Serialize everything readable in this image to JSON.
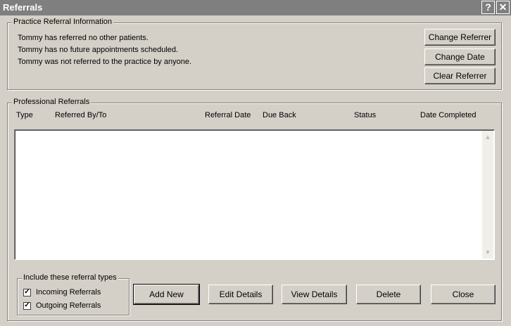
{
  "window": {
    "title": "Referrals",
    "help_glyph": "?",
    "close_glyph": "✕"
  },
  "practice": {
    "legend": "Practice Referral Information",
    "lines": [
      "Tommy has referred no other patients.",
      "Tommy has no future appointments scheduled.",
      "Tommy was not referred to the practice by anyone."
    ],
    "buttons": {
      "change_referrer": "Change Referrer",
      "change_date": "Change Date",
      "clear_referrer": "Clear Referrer"
    }
  },
  "professional": {
    "legend": "Professional Referrals",
    "columns": [
      "Type",
      "Referred By/To",
      "Referral Date",
      "Due Back",
      "Status",
      "Date Completed"
    ],
    "rows": []
  },
  "include": {
    "legend": "Include these referral types",
    "incoming": {
      "label": "Incoming Referrals",
      "checked": true
    },
    "outgoing": {
      "label": "Outgoing Referrals",
      "checked": true
    }
  },
  "actions": {
    "add_new": "Add New",
    "edit_details": "Edit Details",
    "view_details": "View Details",
    "delete": "Delete",
    "close": "Close"
  },
  "icons": {
    "check_glyph": "✓",
    "scroll_up": "▲",
    "scroll_down": "▼"
  }
}
